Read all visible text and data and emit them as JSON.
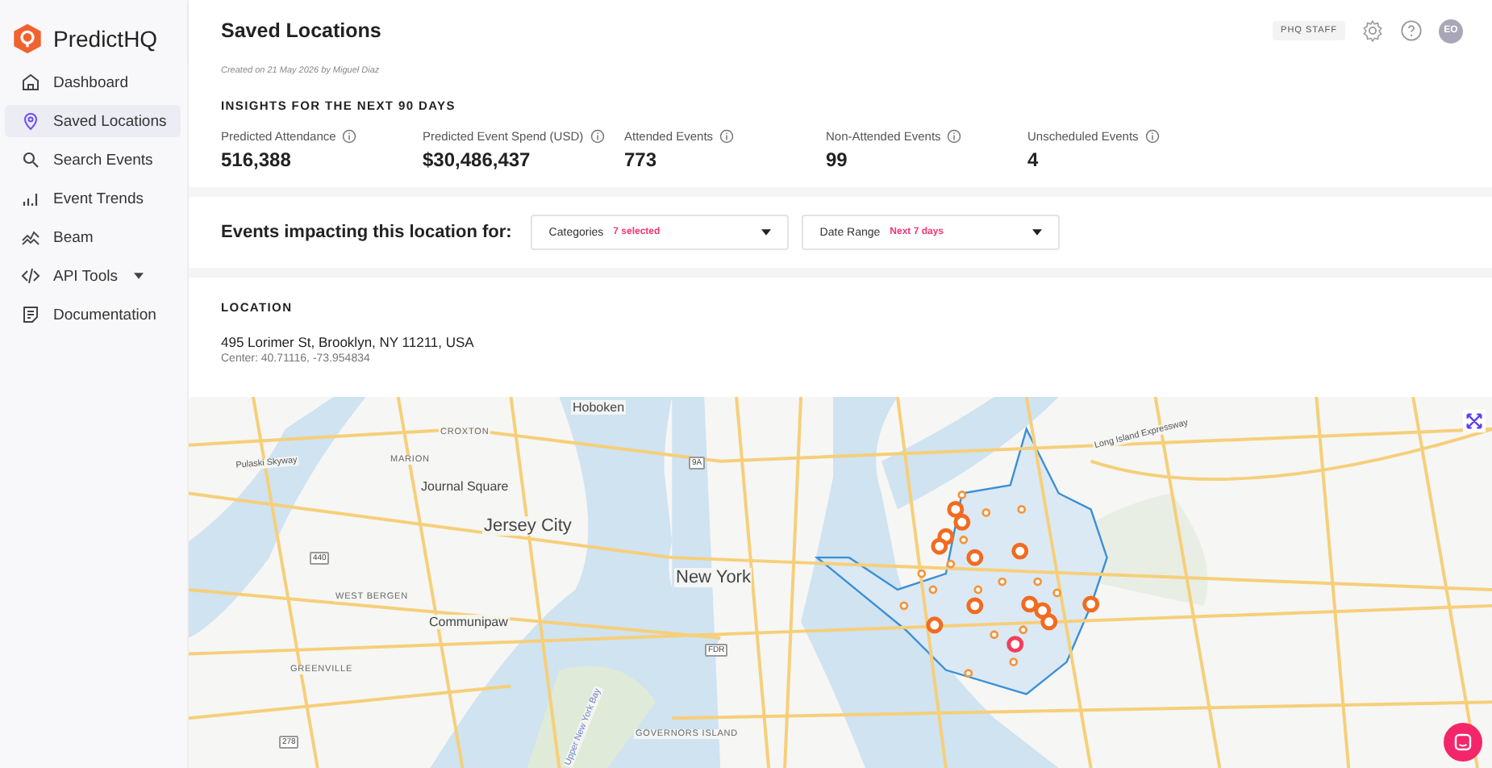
{
  "brand": {
    "name": "PredictHQ"
  },
  "sidebar": {
    "items": [
      {
        "label": "Dashboard",
        "kind": "link",
        "selected": false
      },
      {
        "label": "Saved Locations",
        "kind": "link",
        "selected": true
      },
      {
        "label": "Search Events",
        "kind": "link",
        "selected": false
      },
      {
        "label": "Event Trends",
        "kind": "link",
        "selected": false
      },
      {
        "label": "Beam",
        "kind": "link",
        "selected": false
      },
      {
        "label": "API Tools",
        "kind": "menu",
        "selected": false
      },
      {
        "label": "Documentation",
        "kind": "link",
        "selected": false
      }
    ]
  },
  "header": {
    "title": "Saved Locations",
    "badge": "PHQ STAFF",
    "avatar": "EO"
  },
  "created": "Created on 21 May 2026 by Miguel Diaz",
  "insights": {
    "title": "INSIGHTS FOR THE NEXT 90 DAYS",
    "stats": [
      {
        "label": "Predicted Attendance",
        "value": "516,388"
      },
      {
        "label": "Predicted Event Spend (USD)",
        "value": "$30,486,437"
      },
      {
        "label": "Attended Events",
        "value": "773"
      },
      {
        "label": "Non-Attended Events",
        "value": "99"
      },
      {
        "label": "Unscheduled Events",
        "value": "4"
      }
    ]
  },
  "filters": {
    "title": "Events impacting this location for:",
    "dropdowns": [
      {
        "label": "Categories",
        "value": "7 selected"
      },
      {
        "label": "Date Range",
        "value": "Next 7 days"
      }
    ]
  },
  "location": {
    "title": "LOCATION",
    "address": "495 Lorimer St, Brooklyn, NY 11211, USA",
    "center": "Center: 40.71116, -73.954834"
  },
  "map": {
    "labels": [
      {
        "text": "Hoboken",
        "kind": "place"
      },
      {
        "text": "CROXTON",
        "kind": "district"
      },
      {
        "text": "Long Island Expressway",
        "kind": "road"
      },
      {
        "text": "MARION",
        "kind": "district"
      },
      {
        "text": "9A",
        "kind": "shield"
      },
      {
        "text": "Pulaski Skyway",
        "kind": "road"
      },
      {
        "text": "Journal Square",
        "kind": "place"
      },
      {
        "text": "Jersey City",
        "kind": "city"
      },
      {
        "text": "440",
        "kind": "shield"
      },
      {
        "text": "New York",
        "kind": "city"
      },
      {
        "text": "WEST BERGEN",
        "kind": "district"
      },
      {
        "text": "Communipaw",
        "kind": "place"
      },
      {
        "text": "FDR",
        "kind": "shield"
      },
      {
        "text": "GREENVILLE",
        "kind": "district"
      },
      {
        "text": "Upper New York Bay",
        "kind": "water"
      },
      {
        "text": "GOVERNORS ISLAND",
        "kind": "district"
      },
      {
        "text": "278",
        "kind": "shield"
      }
    ]
  }
}
